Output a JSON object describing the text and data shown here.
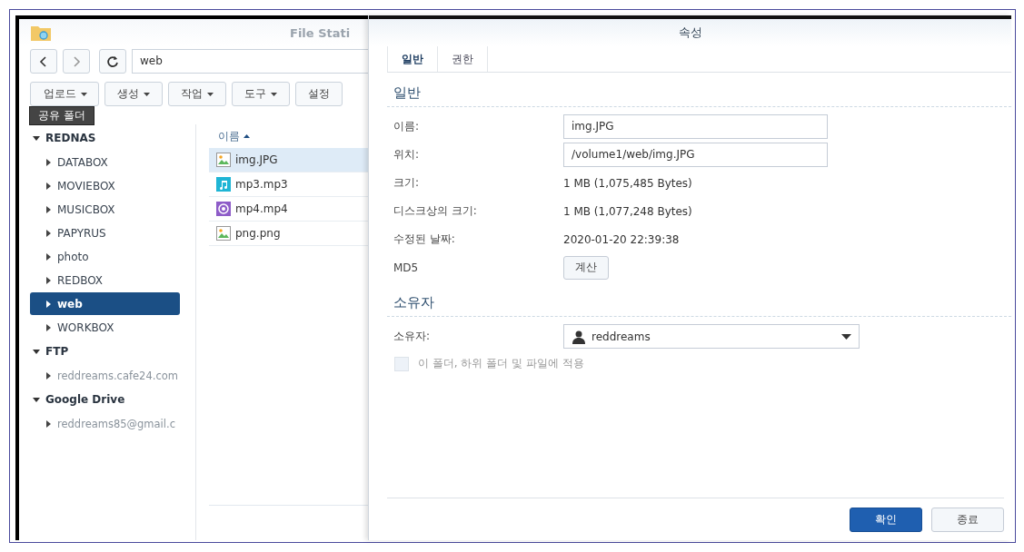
{
  "app": {
    "title": "File Stati",
    "path": "web",
    "column": "이름"
  },
  "toolbar": [
    {
      "label": "업로드",
      "dropdown": true
    },
    {
      "label": "생성",
      "dropdown": true
    },
    {
      "label": "작업",
      "dropdown": true
    },
    {
      "label": "도구",
      "dropdown": true
    },
    {
      "label": "설정",
      "dropdown": false
    }
  ],
  "tooltip": "공유 폴더",
  "sidebar": [
    {
      "label": "REDNAS",
      "expanded": true,
      "children": [
        {
          "label": "DATABOX",
          "selected": false,
          "dimmed": false
        },
        {
          "label": "MOVIEBOX",
          "selected": false,
          "dimmed": false
        },
        {
          "label": "MUSICBOX",
          "selected": false,
          "dimmed": false
        },
        {
          "label": "PAPYRUS",
          "selected": false,
          "dimmed": false
        },
        {
          "label": "photo",
          "selected": false,
          "dimmed": false
        },
        {
          "label": "REDBOX",
          "selected": false,
          "dimmed": false
        },
        {
          "label": "web",
          "selected": true,
          "dimmed": false
        },
        {
          "label": "WORKBOX",
          "selected": false,
          "dimmed": false
        }
      ]
    },
    {
      "label": "FTP",
      "expanded": true,
      "children": [
        {
          "label": "reddreams.cafe24.com",
          "selected": false,
          "dimmed": true
        }
      ]
    },
    {
      "label": "Google Drive",
      "expanded": true,
      "children": [
        {
          "label": "reddreams85@gmail.c",
          "selected": false,
          "dimmed": true
        }
      ]
    }
  ],
  "files": [
    {
      "name": "img.JPG",
      "kind": "image",
      "selected": true
    },
    {
      "name": "mp3.mp3",
      "kind": "audio",
      "selected": false
    },
    {
      "name": "mp4.mp4",
      "kind": "video",
      "selected": false
    },
    {
      "name": "png.png",
      "kind": "image",
      "selected": false
    }
  ],
  "dialog": {
    "title": "속성",
    "tabs": [
      {
        "label": "일반",
        "selected": true
      },
      {
        "label": "권한",
        "selected": false
      }
    ],
    "general_heading": "일반",
    "fields": [
      {
        "label": "이름:",
        "kind": "input",
        "value": "img.JPG"
      },
      {
        "label": "위치:",
        "kind": "input",
        "value": "/volume1/web/img.JPG"
      },
      {
        "label": "크기:",
        "kind": "text",
        "value": "1 MB (1,075,485 Bytes)"
      },
      {
        "label": "디스크상의 크기:",
        "kind": "text",
        "value": "1 MB (1,077,248 Bytes)"
      },
      {
        "label": "수정된 날짜:",
        "kind": "text",
        "value": "2020-01-20 22:39:38"
      },
      {
        "label": "MD5",
        "kind": "button",
        "value": "계산"
      }
    ],
    "owner_heading": "소유자",
    "owner": {
      "label": "소유자:",
      "value": "reddreams"
    },
    "apply": {
      "label": "이 폴더, 하위 폴더 및 파일에 적용",
      "checked": false,
      "disabled": true
    },
    "buttons": [
      {
        "label": "확인",
        "primary": true
      },
      {
        "label": "종료",
        "primary": false
      }
    ]
  }
}
